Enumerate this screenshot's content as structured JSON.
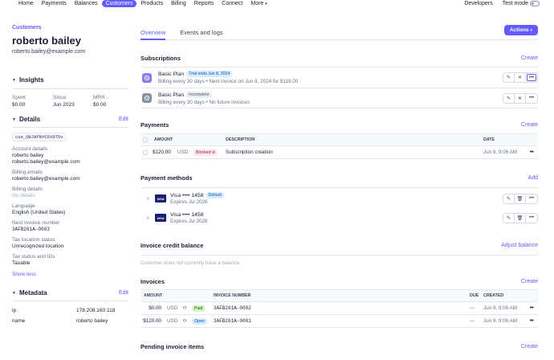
{
  "nav": {
    "items": [
      {
        "label": "Home",
        "active": false
      },
      {
        "label": "Payments",
        "active": false
      },
      {
        "label": "Balances",
        "active": false
      },
      {
        "label": "Customers",
        "active": true
      },
      {
        "label": "Products",
        "active": false
      },
      {
        "label": "Billing",
        "active": false
      },
      {
        "label": "Reports",
        "active": false
      },
      {
        "label": "Connect",
        "active": false
      },
      {
        "label": "More",
        "active": false
      }
    ],
    "more_chevron": "▾",
    "developers": "Developers",
    "test_mode": "Test mode"
  },
  "customer": {
    "breadcrumb": "Customers",
    "name": "roberto bailey",
    "email": "roberto.bailey@example.com"
  },
  "insights": {
    "title": "Insights",
    "cols": [
      {
        "label": "Spent",
        "value": "$0.00"
      },
      {
        "label": "Since",
        "value": "Jun 2023"
      },
      {
        "label": "MRR",
        "value": "$0.00"
      }
    ]
  },
  "details": {
    "title": "Details",
    "edit": "Edit",
    "id": "cus_O8J9fRYC5YDT5v",
    "fields": [
      {
        "label": "Account details",
        "lines": [
          "roberto bailey",
          "roberto.bailey@example.com"
        ]
      },
      {
        "label": "Billing emails",
        "lines": [
          "roberto.bailey@example.com"
        ]
      },
      {
        "label": "Billing details",
        "lines": [
          "No details"
        ],
        "muted": true
      },
      {
        "label": "Language",
        "lines": [
          "English (United States)"
        ]
      },
      {
        "label": "Next invoice number",
        "lines": [
          "3AFB261A-0003"
        ],
        "mono": true
      },
      {
        "label": "Tax location status",
        "lines": [
          "Unrecognized location"
        ]
      },
      {
        "label": "Tax status and IDs",
        "lines": [
          "Taxable"
        ]
      }
    ],
    "show_less": "Show less"
  },
  "metadata": {
    "title": "Metadata",
    "edit": "Edit",
    "rows": [
      {
        "key": "ip",
        "value": "178.208.160.118"
      },
      {
        "key": "name",
        "value": "roberto bailey"
      }
    ]
  },
  "tabs": [
    {
      "label": "Overview",
      "active": true
    },
    {
      "label": "Events and logs",
      "active": false
    }
  ],
  "actions_label": "Actions",
  "actions_chevron": "▾",
  "subscriptions": {
    "title": "Subscriptions",
    "action": "Create",
    "rows": [
      {
        "plan": "Basic Plan",
        "badge": "Trial ends Jun 8, 2024",
        "desc": "Billing every 30 days • Next invoice on Jun 8, 2024 for $119.00"
      },
      {
        "plan": "Basic Plan",
        "badge": "Incomplete",
        "desc": "Billing every 30 days • No future invoices"
      }
    ]
  },
  "payments": {
    "title": "Payments",
    "action": "Create",
    "headers": {
      "amount": "AMOUNT",
      "description": "DESCRIPTION",
      "date": "DATE"
    },
    "rows": [
      {
        "amount": "$120.00",
        "currency": "USD",
        "status": "Blocked",
        "description": "Subscription creation",
        "date": "Jun 9, 9:06 AM"
      }
    ]
  },
  "payment_methods": {
    "title": "Payment methods",
    "action": "Add",
    "cards": [
      {
        "brand": "VISA",
        "label": "Visa •••• 1458",
        "badge": "Default",
        "expires": "Expires Jul 2028"
      },
      {
        "brand": "VISA",
        "label": "Visa •••• 1458",
        "badge": "",
        "expires": "Expires Jul 2028"
      }
    ]
  },
  "credit_balance": {
    "title": "Invoice credit balance",
    "action": "Adjust balance",
    "note": "Customer does not currently have a balance."
  },
  "invoices": {
    "title": "Invoices",
    "action": "Create",
    "headers": {
      "amount": "AMOUNT",
      "number": "INVOICE NUMBER",
      "due": "DUE",
      "created": "CREATED"
    },
    "rows": [
      {
        "amount": "$0.00",
        "currency": "USD",
        "status": "Paid",
        "number": "3AFB261A-0002",
        "due": "—",
        "created": "Jun 9, 9:06 AM"
      },
      {
        "amount": "$120.00",
        "currency": "USD",
        "status": "Open",
        "number": "3AFB261A-0001",
        "due": "—",
        "created": "Jun 9, 9:06 AM"
      }
    ]
  },
  "pending_items": {
    "title": "Pending invoice items",
    "action": "Create"
  }
}
